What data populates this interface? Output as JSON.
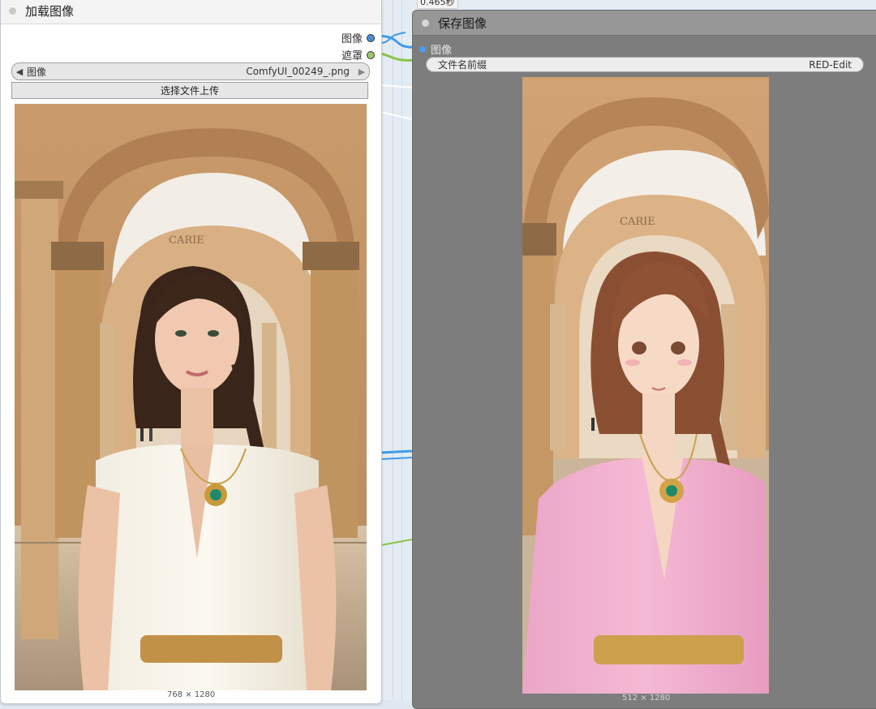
{
  "time_badge": "0.465秒",
  "load_node": {
    "title": "加载图像",
    "outputs": [
      {
        "label": "图像",
        "port_color": "#4a8fd6"
      },
      {
        "label": "遮罩",
        "port_color": "#9cc76a"
      }
    ],
    "image_combo": {
      "label": "图像",
      "value": "ComfyUI_00249_.png",
      "prev_icon": "◀",
      "next_icon": "▶"
    },
    "upload_button": "选择文件上传",
    "image_size": "768 × 1280",
    "image_description_icon": "photo-woman-arches"
  },
  "save_node": {
    "title": "保存图像",
    "input": {
      "label": "图像",
      "port_color": "#4b9cf0"
    },
    "filename_prefix": {
      "label": "文件名前缀",
      "value": "RED-Edit"
    },
    "image_size": "512 × 1280",
    "image_description_icon": "anime-woman-arches"
  },
  "colors": {
    "canvas": "#e4ecf3",
    "left_node_bg": "#ffffff",
    "right_node_bg": "#7d7d7d",
    "link_blue": "#3f9be8",
    "link_green": "#8bc34a"
  }
}
